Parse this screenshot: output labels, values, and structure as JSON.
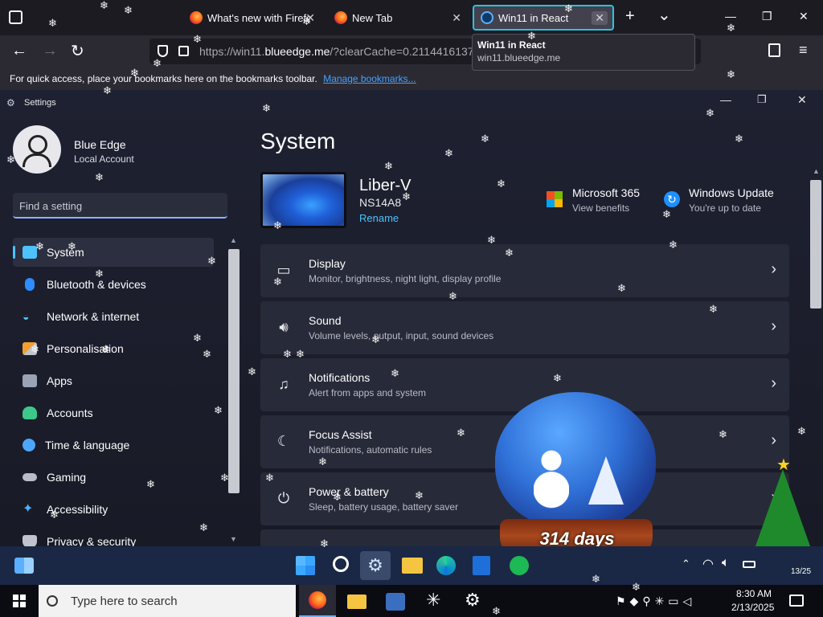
{
  "browser": {
    "tabs": [
      {
        "title": "What's new with Firefox",
        "close": "✕"
      },
      {
        "title": "New Tab",
        "close": "✕"
      },
      {
        "title": "Win11 in React",
        "close": "✕"
      }
    ],
    "new_tab": "+",
    "list_tabs": "⌄",
    "window_controls": [
      "—",
      "❐",
      "✕"
    ],
    "url_prefix": "https://win11.",
    "url_domain": "blueedge.me",
    "url_suffix": "/?clearCache=0.2114416137",
    "tooltip": {
      "title": "Win11 in React",
      "url": "win11.blueedge.me"
    },
    "bookmarks_text": "For quick access, place your bookmarks here on the bookmarks toolbar.",
    "bookmarks_link": "Manage bookmarks..."
  },
  "settings": {
    "window_title": "Settings",
    "user_name": "Blue Edge",
    "account_type": "Local Account",
    "search_placeholder": "Find a setting",
    "nav": [
      {
        "label": "System",
        "icon": "monitor-icon",
        "color": "#4cc2ff"
      },
      {
        "label": "Bluetooth & devices",
        "icon": "bluetooth-icon",
        "color": "#2f8cff"
      },
      {
        "label": "Network & internet",
        "icon": "wifi-icon",
        "color": "#4cc2ff"
      },
      {
        "label": "Personalisation",
        "icon": "brush-icon",
        "color": "#f0a030"
      },
      {
        "label": "Apps",
        "icon": "apps-icon",
        "color": "#9aa3b5"
      },
      {
        "label": "Accounts",
        "icon": "person-icon",
        "color": "#3cc88a"
      },
      {
        "label": "Time & language",
        "icon": "globe-icon",
        "color": "#4ca8ff"
      },
      {
        "label": "Gaming",
        "icon": "gamepad-icon",
        "color": "#b8bcc8"
      },
      {
        "label": "Accessibility",
        "icon": "accessibility-icon",
        "color": "#4cb0ff"
      },
      {
        "label": "Privacy & security",
        "icon": "shield-icon",
        "color": "#c0c4cc"
      }
    ],
    "page_title": "System",
    "device_name": "Liber-V",
    "device_model": "NS14A8",
    "rename_label": "Rename",
    "ms365_title": "Microsoft 365",
    "ms365_sub": "View benefits",
    "update_title": "Windows Update",
    "update_sub": "You're up to date",
    "cards": [
      {
        "title": "Display",
        "subtitle": "Monitor, brightness, night light, display profile",
        "icon": "display-icon"
      },
      {
        "title": "Sound",
        "subtitle": "Volume levels, output, input, sound devices",
        "icon": "speaker-icon"
      },
      {
        "title": "Notifications",
        "subtitle": "Alert from apps and system",
        "icon": "bell-icon"
      },
      {
        "title": "Focus Assist",
        "subtitle": "Notifications, automatic rules",
        "icon": "moon-icon"
      },
      {
        "title": "Power & battery",
        "subtitle": "Sleep, battery usage, battery saver",
        "icon": "power-icon"
      }
    ]
  },
  "snow_globe_label": "314 days",
  "taskbar": {
    "date_partial": "13/25",
    "search_placeholder": "Type here to search",
    "time": "8:30 AM",
    "date": "2/13/2025"
  },
  "colors": {
    "accent": "#2ac3de",
    "link": "#45a1ff",
    "taskbar_top": "#1a2845"
  }
}
